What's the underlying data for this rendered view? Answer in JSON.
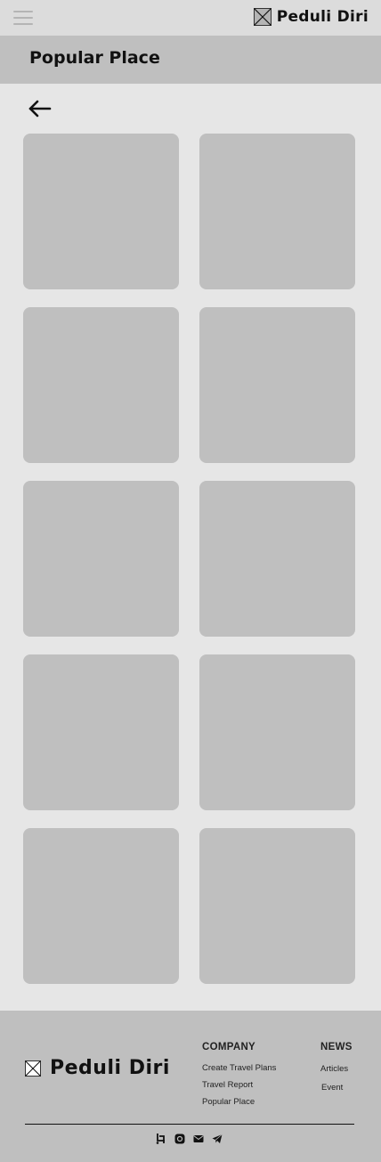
{
  "header": {
    "brand_name": "Peduli Diri",
    "menu_icon": "hamburger-menu-icon",
    "logo_icon": "image-placeholder-logo"
  },
  "page": {
    "title": "Popular Place",
    "back_icon": "arrow-left-icon"
  },
  "places": [
    {
      "id": 1
    },
    {
      "id": 2
    },
    {
      "id": 3
    },
    {
      "id": 4
    },
    {
      "id": 5
    },
    {
      "id": 6
    },
    {
      "id": 7
    },
    {
      "id": 8
    },
    {
      "id": 9
    },
    {
      "id": 10
    }
  ],
  "footer": {
    "brand_name": "Peduli Diri",
    "company": {
      "heading": "COMPANY",
      "links": [
        "Create Travel Plans",
        "Travel Report",
        "Popular Place"
      ]
    },
    "news": {
      "heading": "NEWS",
      "links": [
        "Articles",
        "Event"
      ]
    },
    "social_icons": [
      "share-icon",
      "instagram-icon",
      "email-icon",
      "telegram-icon"
    ]
  },
  "colors": {
    "page_background": "#e6e6e6",
    "topbar": "#dcdcdc",
    "title_band": "#bfbfbf",
    "card": "#bfbfbf",
    "footer": "#bfbfbf"
  }
}
